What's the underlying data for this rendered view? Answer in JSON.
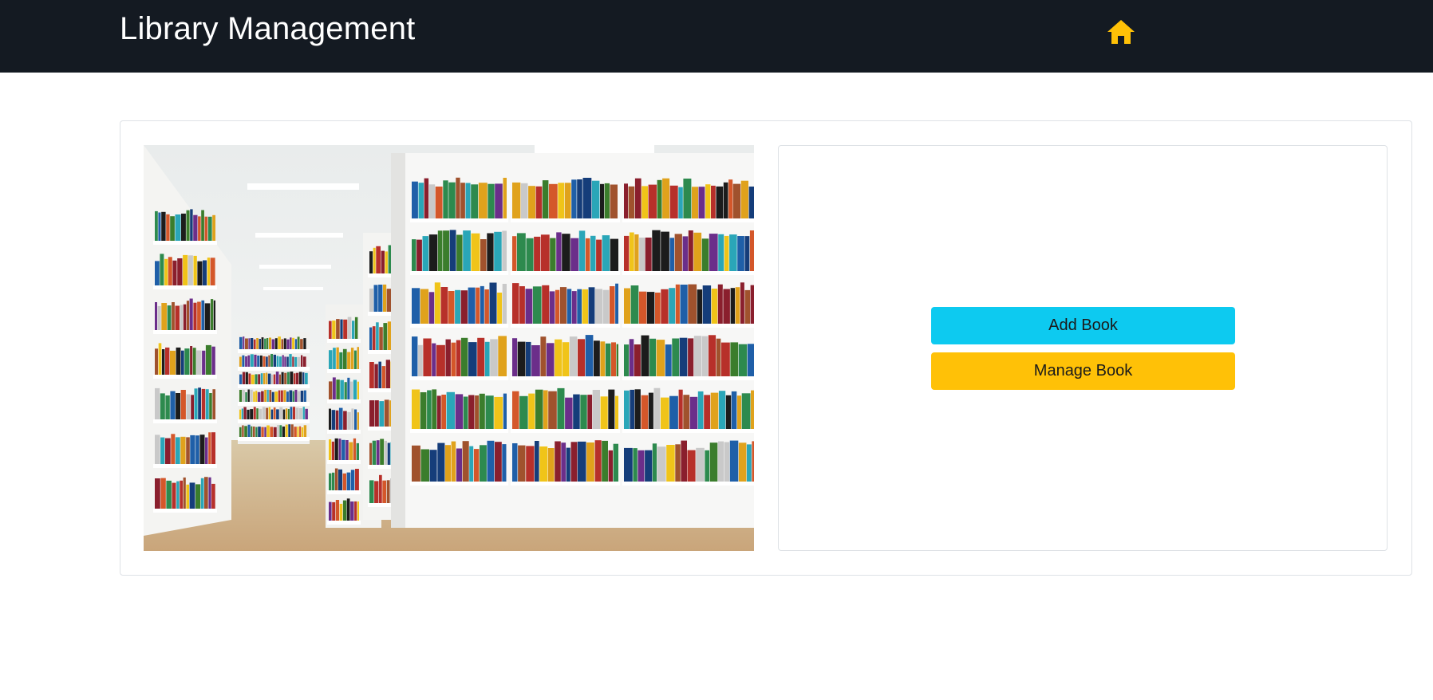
{
  "navbar": {
    "brand": "Library Management",
    "home_icon": "home-icon",
    "background": "#141a22",
    "home_icon_color": "#ffc107"
  },
  "hero_image": {
    "subject": "library-bookshelves-illustration"
  },
  "actions": {
    "add_book_label": "Add Book",
    "add_book_color": "#0dcaf0",
    "manage_book_label": "Manage Book",
    "manage_book_color": "#ffc107"
  }
}
